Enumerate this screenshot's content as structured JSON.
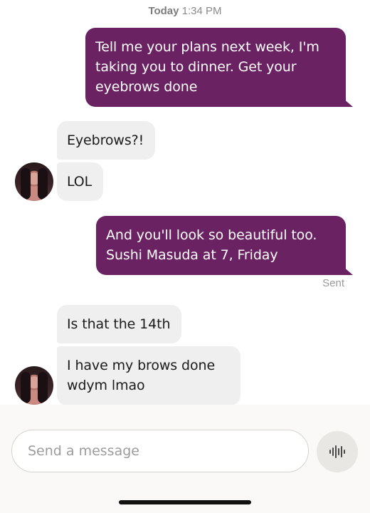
{
  "thread": {
    "timestamp_day": "Today",
    "timestamp_time": "1:34 PM",
    "messages": [
      {
        "direction": "out",
        "text": "Tell me your plans next week, I'm taking you to dinner. Get your eyebrows done"
      },
      {
        "direction": "in",
        "text": "Eyebrows?!"
      },
      {
        "direction": "in",
        "text": "LOL"
      },
      {
        "direction": "out",
        "text": "And you'll look so beautiful too. Sushi Masuda at 7, Friday"
      },
      {
        "direction": "in",
        "text": "Is that the 14th"
      },
      {
        "direction": "in",
        "text": "I have my brows done wdym lmao"
      }
    ],
    "sent_status": "Sent"
  },
  "composer": {
    "placeholder": "Send a message",
    "voice_icon": "waveform-icon"
  },
  "colors": {
    "outgoing_bubble": "#6b2263",
    "incoming_bubble": "#efefef"
  }
}
